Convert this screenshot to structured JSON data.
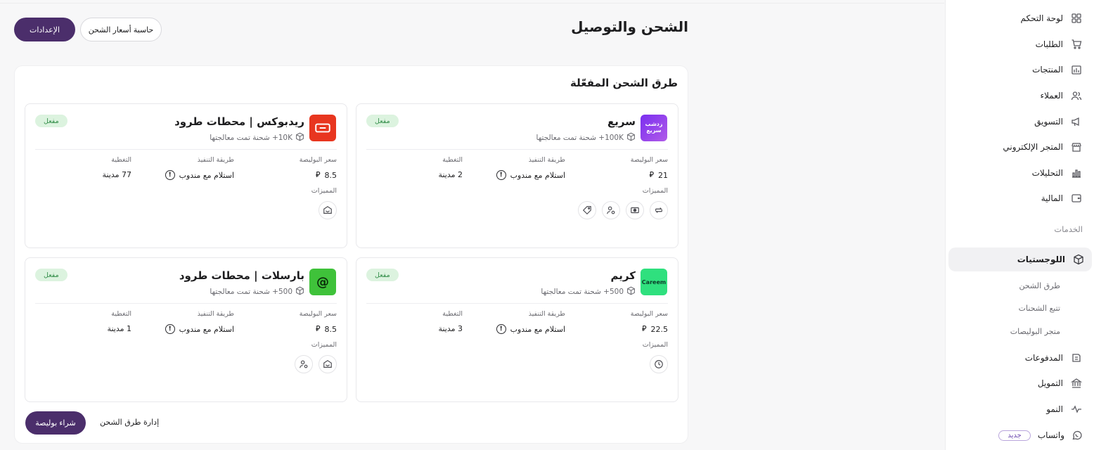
{
  "page": {
    "title": "الشحن والتوصيل",
    "settings_button": "الإعدادات",
    "calculator_button": "حاسبة أسعار الشحن"
  },
  "sidebar": {
    "items": [
      {
        "label": "لوحة التحكم",
        "icon": "dashboard-icon"
      },
      {
        "label": "الطلبات",
        "icon": "cart-icon"
      },
      {
        "label": "المنتجات",
        "icon": "products-icon"
      },
      {
        "label": "العملاء",
        "icon": "users-icon"
      },
      {
        "label": "التسويق",
        "icon": "megaphone-icon"
      },
      {
        "label": "المتجر الإلكتروني",
        "icon": "store-icon"
      },
      {
        "label": "التحليلات",
        "icon": "analytics-icon"
      },
      {
        "label": "المالية",
        "icon": "wallet-icon"
      }
    ],
    "section_label": "الخدمات",
    "services": [
      {
        "label": "اللوجستيات",
        "icon": "box-icon",
        "active": true
      },
      {
        "label": "المدفوعات",
        "icon": "payments-icon"
      },
      {
        "label": "التمويل",
        "icon": "bank-icon"
      },
      {
        "label": "النمو",
        "icon": "pulse-icon"
      },
      {
        "label": "واتساب",
        "icon": "whatsapp-icon",
        "badge": "جديد"
      }
    ],
    "logistics_sub": [
      "طرق الشحن",
      "تتبع الشحنات",
      "متجر البوليصات"
    ]
  },
  "panel": {
    "title": "طرق الشحن المفعّلة",
    "col_price": "سعر البوليصة",
    "col_method": "طريقة التنفيذ",
    "col_coverage": "التغطية",
    "features_label": "المميزات",
    "buy_button": "شراء بوليصة",
    "manage_link": "إدارة طرق الشحن"
  },
  "cards": [
    {
      "name": "سريع",
      "subtitle": "100K+ شحنة تمت معالجتها",
      "status": "مفعل",
      "price": "21",
      "method": "استلام مع مندوب",
      "coverage": "2 مدينة",
      "logo_text": "زدشب سريع",
      "logo_color": "#8a3ff0",
      "features": [
        "swap-icon",
        "cash-icon",
        "user-location-icon",
        "tag-icon"
      ]
    },
    {
      "name": "ريدبوكس | محطات طرود",
      "subtitle": "10K+ شحنة تمت معالجتها",
      "status": "مفعل",
      "price": "8.5",
      "method": "استلام مع مندوب",
      "coverage": "77 مدينة",
      "logo_text": "",
      "logo_color": "#e8361f",
      "features": [
        "locker-icon"
      ]
    },
    {
      "name": "كريم",
      "subtitle": "500+ شحنة تمت معالجتها",
      "status": "مفعل",
      "price": "22.5",
      "method": "استلام مع مندوب",
      "coverage": "3 مدينة",
      "logo_text": "Careem",
      "logo_color": "#2fe07e",
      "features": [
        "clock-icon"
      ]
    },
    {
      "name": "بارسلات | محطات طرود",
      "subtitle": "500+ شحنة تمت معالجتها",
      "status": "مفعل",
      "price": "8.5",
      "method": "استلام مع مندوب",
      "coverage": "1 مدينة",
      "logo_text": "@",
      "logo_color": "#3fc23a",
      "features": [
        "locker-icon",
        "user-location-icon"
      ]
    }
  ]
}
